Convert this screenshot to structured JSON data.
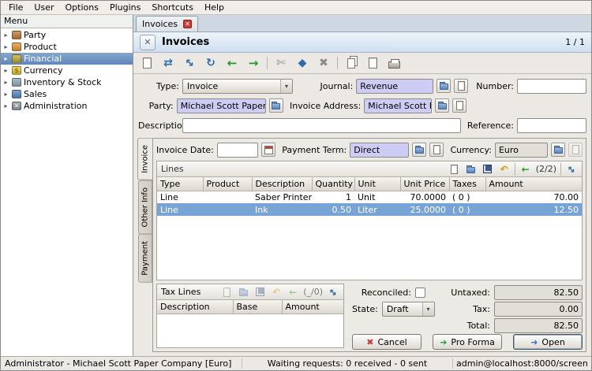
{
  "menubar": {
    "items": [
      "File",
      "User",
      "Options",
      "Plugins",
      "Shortcuts",
      "Help"
    ]
  },
  "sidebar": {
    "title": "Menu",
    "items": [
      {
        "label": "Party"
      },
      {
        "label": "Product"
      },
      {
        "label": "Financial",
        "selected": true
      },
      {
        "label": "Currency"
      },
      {
        "label": "Inventory & Stock"
      },
      {
        "label": "Sales"
      },
      {
        "label": "Administration"
      }
    ]
  },
  "tab": {
    "label": "Invoices"
  },
  "header": {
    "title": "Invoices",
    "pager": "1 / 1"
  },
  "toolbar": {
    "icons": [
      "new",
      "switch-view",
      "fullscreen",
      "reload",
      "previous",
      "next",
      "attach",
      "note",
      "delete",
      "duplicate",
      "export",
      "print"
    ]
  },
  "form": {
    "type_label": "Type:",
    "type_value": "Invoice",
    "journal_label": "Journal:",
    "journal_value": "Revenue",
    "number_label": "Number:",
    "number_value": "",
    "party_label": "Party:",
    "party_value": "Michael Scott Paper Co",
    "invoice_address_label": "Invoice Address:",
    "invoice_address_value": "Michael Scott Paper Co",
    "description_label": "Description:",
    "description_value": "",
    "reference_label": "Reference:",
    "reference_value": "",
    "invoice_date_label": "Invoice Date:",
    "invoice_date_value": "",
    "payment_term_label": "Payment Term:",
    "payment_term_value": "Direct",
    "currency_label": "Currency:",
    "currency_value": "Euro"
  },
  "side_tabs": {
    "invoice": "Invoice",
    "other_info": "Other Info",
    "payment": "Payment"
  },
  "lines": {
    "title": "Lines",
    "pager": "(2/2)",
    "toolbar_icons": [
      "new",
      "open",
      "save",
      "undo",
      "previous",
      "expand"
    ],
    "columns": [
      "Type",
      "Product",
      "Description",
      "Quantity",
      "Unit",
      "Unit Price",
      "Taxes",
      "Amount"
    ],
    "rows": [
      {
        "type": "Line",
        "product": "",
        "description": "Saber Printer",
        "quantity": "1",
        "unit": "Unit",
        "unit_price": "70.0000",
        "taxes": "( 0 )",
        "amount": "70.00"
      },
      {
        "type": "Line",
        "product": "",
        "description": "Ink",
        "quantity": "0.50",
        "unit": "Liter",
        "unit_price": "25.0000",
        "taxes": "( 0 )",
        "amount": "12.50"
      }
    ]
  },
  "tax_lines": {
    "title": "Tax Lines",
    "pager": "(_/0)",
    "toolbar_icons": [
      "new",
      "open",
      "save",
      "undo",
      "previous",
      "expand"
    ],
    "columns": [
      "Description",
      "Base",
      "Amount"
    ]
  },
  "summary": {
    "reconciled_label": "Reconciled:",
    "state_label": "State:",
    "state_value": "Draft",
    "untaxed_label": "Untaxed:",
    "untaxed_value": "82.50",
    "tax_label": "Tax:",
    "tax_value": "0.00",
    "total_label": "Total:",
    "total_value": "82.50"
  },
  "buttons": {
    "cancel": "Cancel",
    "pro_forma": "Pro Forma",
    "open": "Open"
  },
  "statusbar": {
    "left": "Administrator - Michael Scott Paper Company [Euro]",
    "center": "Waiting requests: 0 received - 0 sent",
    "right": "admin@localhost:8000/screenshot"
  },
  "colors": {
    "selection_blue": "#6b93c4",
    "required_field": "#ccccf5",
    "selected_row": "#77a4d4",
    "tab_close_red": "#cc3b33"
  }
}
